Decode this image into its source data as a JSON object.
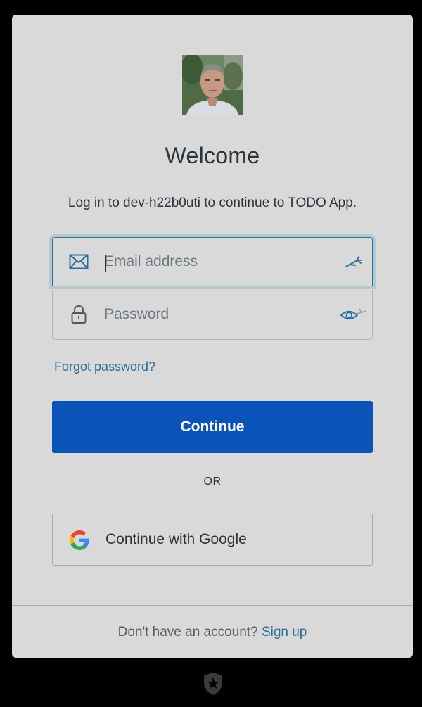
{
  "login": {
    "heading": "Welcome",
    "subtitle": "Log in to dev-h22b0uti to continue to TODO App.",
    "email_placeholder": "Email address",
    "password_placeholder": "Password",
    "forgot_password": "Forgot password?",
    "continue_label": "Continue",
    "separator": "OR",
    "google_label": "Continue with Google"
  },
  "footer": {
    "prompt": "Don't have an account?",
    "signup": "Sign up"
  },
  "icons": {
    "email": "envelope-icon",
    "password": "lock-icon",
    "reveal": "eye-icon",
    "autofill": "autofill-key-icon",
    "google": "google-g-icon",
    "brand": "shield-star-icon"
  },
  "colors": {
    "primary": "#0a53b8",
    "link": "#2a6f9a",
    "card": "#d9d9d9",
    "text": "#2d333a"
  }
}
